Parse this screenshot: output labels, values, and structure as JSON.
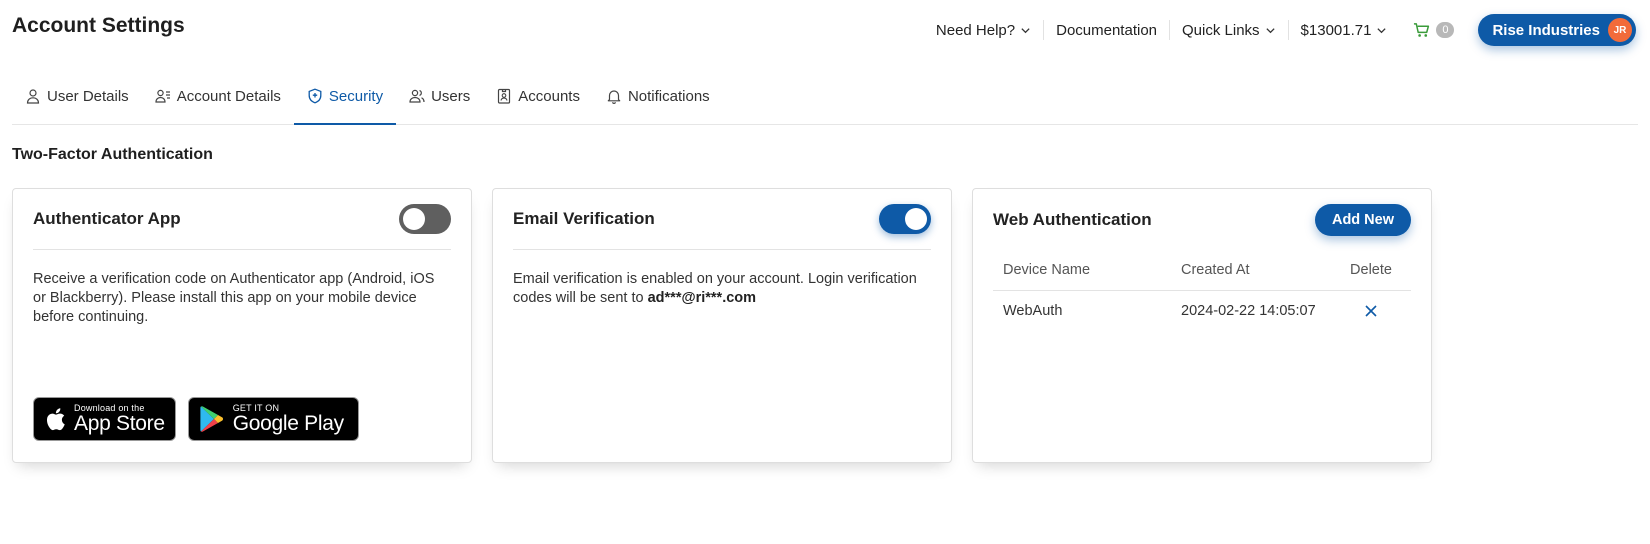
{
  "page": {
    "title": "Account Settings"
  },
  "topnav": {
    "need_help": "Need Help?",
    "documentation": "Documentation",
    "quick_links": "Quick Links",
    "balance": "$13001.71",
    "cart_count": "0",
    "company": "Rise Industries",
    "avatar_initials": "JR"
  },
  "tabs": [
    {
      "label": "User Details",
      "icon": "user-icon"
    },
    {
      "label": "Account Details",
      "icon": "account-details-icon"
    },
    {
      "label": "Security",
      "icon": "shield-icon",
      "active": true
    },
    {
      "label": "Users",
      "icon": "users-icon"
    },
    {
      "label": "Accounts",
      "icon": "id-badge-icon"
    },
    {
      "label": "Notifications",
      "icon": "bell-icon"
    }
  ],
  "section": {
    "title": "Two-Factor Authentication"
  },
  "authenticator": {
    "title": "Authenticator App",
    "enabled": false,
    "description": "Receive a verification code on Authenticator app (Android, iOS or Blackberry). Please install this app on your mobile device before continuing.",
    "app_store_small": "Download on the",
    "app_store_big": "App Store",
    "google_play_small": "GET IT ON",
    "google_play_big": "Google Play"
  },
  "email": {
    "title": "Email Verification",
    "enabled": true,
    "description": "Email verification is enabled on your account. Login verification codes will be sent to",
    "address": "ad***@ri***.com"
  },
  "webauth": {
    "title": "Web Authentication",
    "add_label": "Add New",
    "columns": {
      "device": "Device Name",
      "created": "Created At",
      "delete": "Delete"
    },
    "rows": [
      {
        "device": "WebAuth",
        "created": "2024-02-22 14:05:07"
      }
    ]
  },
  "colors": {
    "primary": "#0e5aa7",
    "avatar": "#f26b3a",
    "cart": "#3a9b3a"
  }
}
